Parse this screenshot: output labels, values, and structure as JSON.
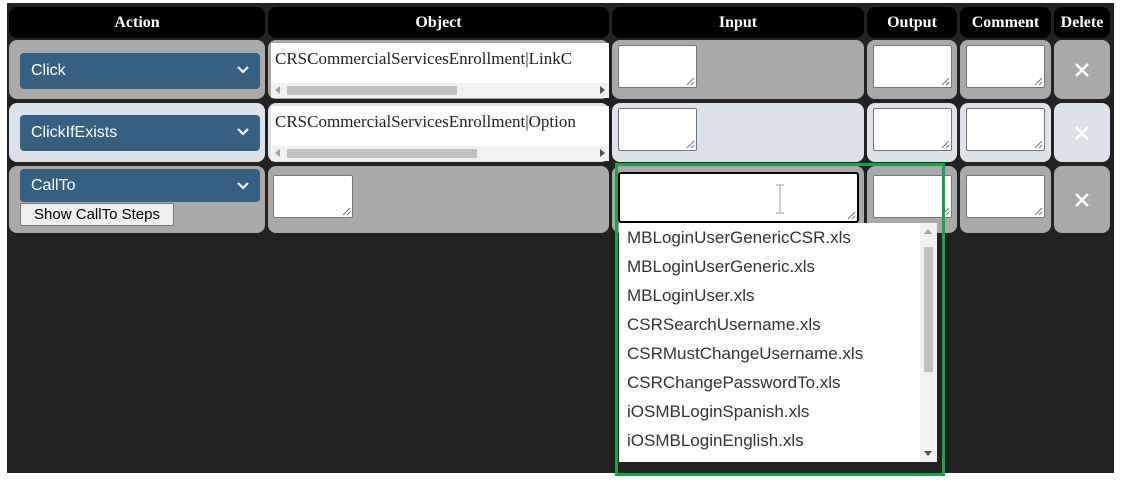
{
  "headers": {
    "action": "Action",
    "object": "Object",
    "input": "Input",
    "output": "Output",
    "comment": "Comment",
    "delete": "Delete"
  },
  "rows": [
    {
      "action": "Click",
      "object": "CRSCommercialServicesEnrollment|LinkC"
    },
    {
      "action": "ClickIfExists",
      "object": "CRSCommercialServicesEnrollment|Option"
    },
    {
      "action": "CallTo",
      "show_steps_label": "Show CallTo Steps"
    }
  ],
  "dropdown": {
    "items": [
      "MBLoginUserGenericCSR.xls",
      "MBLoginUserGeneric.xls",
      "MBLoginUser.xls",
      "CSRSearchUsername.xls",
      "CSRMustChangeUsername.xls",
      "CSRChangePasswordTo.xls",
      "iOSMBLoginSpanish.xls",
      "iOSMBLoginEnglish.xls"
    ]
  },
  "colors": {
    "select_bg": "#356081",
    "cell_grey": "#a9a9a9",
    "cell_light": "#dde2ea",
    "highlight": "#1aa34a"
  },
  "icons": {
    "chevron": "chevron-down-icon",
    "delete": "close-icon"
  }
}
